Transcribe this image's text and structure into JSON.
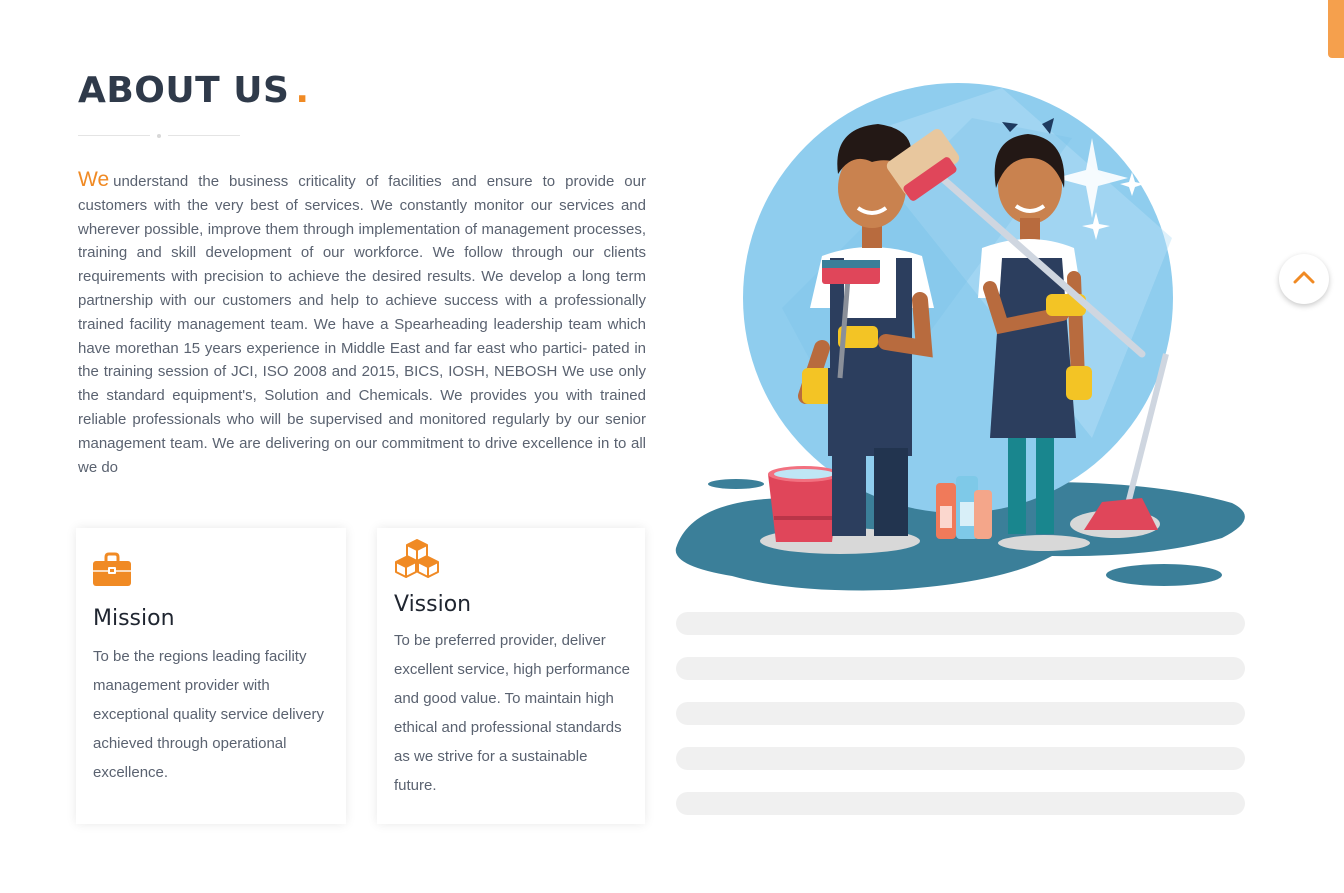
{
  "about": {
    "heading": "ABOUT US",
    "heading_dot": ".",
    "intro_lead": "We",
    "intro_text": "understand the business criticality of facilities and ensure to provide our customers with the very best of services. We constantly monitor our services and wherever possible, improve them through implementation of management processes, training and skill development of our workforce. We follow through our clients requirements with precision to achieve the desired results. We develop a long term partnership with our customers and help to achieve success with a professionally trained facility management team. We have a Spearheading leadership team which have morethan 15 years experience in Middle East and far east who partici- pated in the training session of JCI, ISO 2008 and 2015, BICS, IOSH, NEBOSH We use only the standard equipment's, Solution and Chemicals. We provides you with trained reliable professionals who will be supervised and monitored regularly by our senior management team. We are delivering on our commitment to drive excellence in to all we do"
  },
  "mission": {
    "icon": "briefcase-icon",
    "title": "Mission",
    "text": "To be the regions leading facility management provider with exceptional quality service delivery achieved through operational excellence."
  },
  "vision": {
    "icon": "cubes-icon",
    "title": "Vission",
    "text": "To be preferred provider, deliver excellent service, high performance and good value. To maintain high ethical and professional standards as we strive for a sustainable future."
  },
  "scroll_top": {
    "icon": "chevron-up-icon"
  },
  "illustration": {
    "subject": "cleaning-staff-illustration"
  },
  "colors": {
    "accent": "#f08a24",
    "heading": "#2f3a4a",
    "body_text": "#5a6270",
    "placeholder_bar": "#f0f0f0",
    "circle_bg": "#8fcdee",
    "floor": "#3b7f99"
  }
}
